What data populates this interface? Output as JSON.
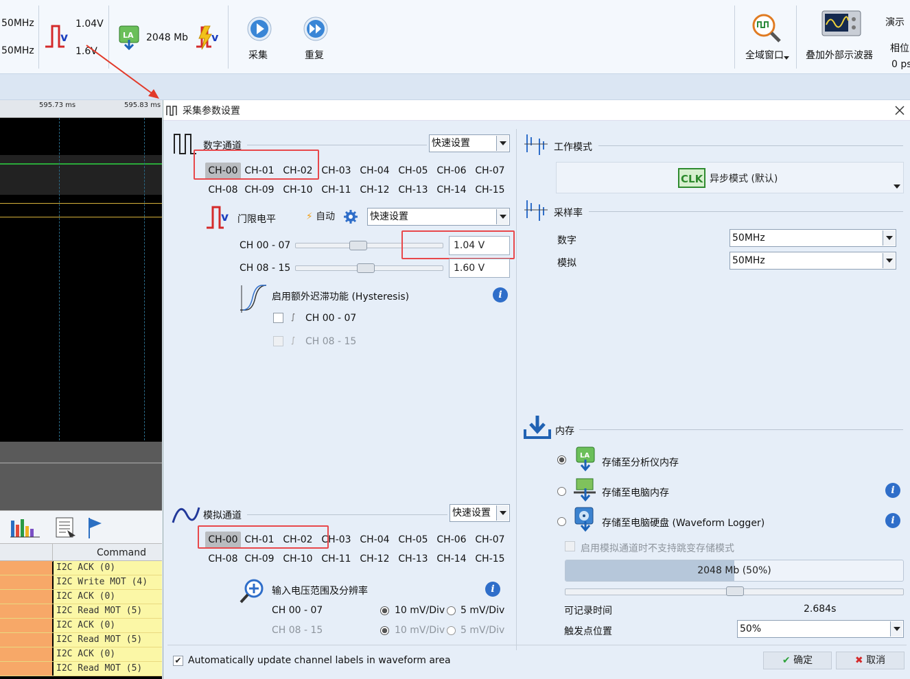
{
  "toolbar": {
    "rate_digital": "50MHz",
    "rate_analog": "50MHz",
    "thr_high": "1.04V",
    "thr_low": "1.6V",
    "memory": "2048 Mb",
    "acquire_label": "采集",
    "repeat_label": "重复",
    "global_window_label": "全域窗口",
    "overlay_scope_label": "叠加外部示波器",
    "demo_label": "演示",
    "phase_label": "相位",
    "phase_value": "0 ps"
  },
  "left": {
    "ruler_t1": "595.73 ms",
    "ruler_t2": "595.83 ms",
    "command_header": "Command",
    "commands": [
      "I2C ACK (0)",
      "I2C Write MOT (4)",
      "I2C ACK (0)",
      "I2C Read MOT (5)",
      "I2C ACK (0)",
      "I2C Read MOT (5)",
      "I2C ACK (0)",
      "I2C Read MOT (5)"
    ]
  },
  "dialog": {
    "title": "采集参数设置",
    "digital": {
      "title": "数字通道",
      "quick": "快速设置",
      "channels_row1": [
        "CH-00",
        "CH-01",
        "CH-02",
        "CH-03",
        "CH-04",
        "CH-05",
        "CH-06",
        "CH-07"
      ],
      "channels_row2": [
        "CH-08",
        "CH-09",
        "CH-10",
        "CH-11",
        "CH-12",
        "CH-13",
        "CH-14",
        "CH-15"
      ],
      "threshold_label": "门限电平",
      "auto_label": "自动",
      "threshold_quick": "快速设置",
      "grp1_label": "CH 00 - 07",
      "grp1_value": "1.04 V",
      "grp1_level": 0.42,
      "grp2_label": "CH 08 - 15",
      "grp2_value": "1.60 V",
      "grp2_level": 0.47,
      "hysteresis_label": "启用额外迟滞功能 (Hysteresis)",
      "hyst1": "CH 00 - 07",
      "hyst2": "CH 08 - 15"
    },
    "analog": {
      "title": "模拟通道",
      "quick": "快速设置",
      "channels_row1": [
        "CH-00",
        "CH-01",
        "CH-02",
        "CH-03",
        "CH-04",
        "CH-05",
        "CH-06",
        "CH-07"
      ],
      "channels_row2": [
        "CH-08",
        "CH-09",
        "CH-10",
        "CH-11",
        "CH-12",
        "CH-13",
        "CH-14",
        "CH-15"
      ],
      "range_label": "输入电压范围及分辨率",
      "g1": "CH 00 - 07",
      "g2": "CH 08 - 15",
      "opt1": "10 mV/Div",
      "opt2": "5 mV/Div"
    },
    "mode": {
      "title": "工作模式",
      "value": "异步模式 (默认)",
      "clk": "CLK"
    },
    "rate": {
      "title": "采样率",
      "digital_label": "数字",
      "digital_value": "50MHz",
      "analog_label": "模拟",
      "analog_value": "50MHz"
    },
    "memory": {
      "title": "内存",
      "opt1": "存储至分析仪内存",
      "opt2": "存储至电脑内存",
      "opt3": "存储至电脑硬盘 (Waveform Logger)",
      "note": "启用模拟通道时不支持跳变存储模式",
      "bar_text": "2048 Mb (50%)",
      "bar_fraction": 0.5,
      "record_time_label": "可记录时间",
      "record_time_value": "2.684s",
      "trigger_label": "触发点位置",
      "trigger_value": "50%"
    },
    "auto_update_label": "Automatically update channel labels in waveform area",
    "ok": "确定",
    "cancel": "取消"
  }
}
